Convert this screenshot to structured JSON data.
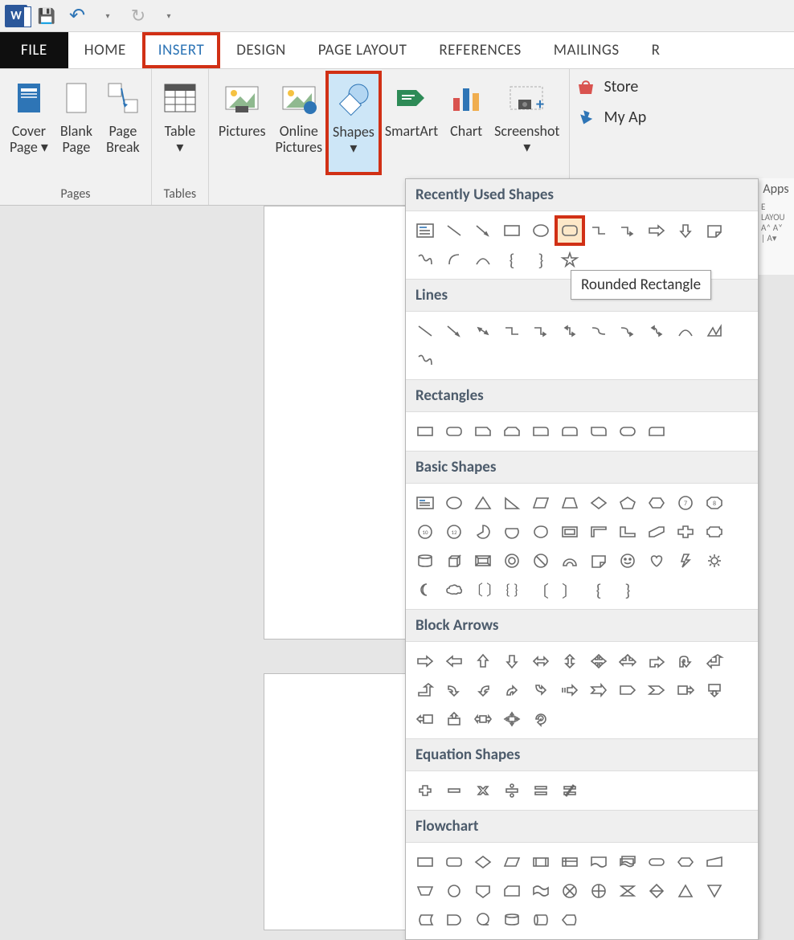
{
  "qat": {
    "save": "💾",
    "undo": "↶",
    "redo": "↻"
  },
  "tabs": [
    "FILE",
    "HOME",
    "INSERT",
    "DESIGN",
    "PAGE LAYOUT",
    "REFERENCES",
    "MAILINGS",
    "R"
  ],
  "ribbon": {
    "pages": {
      "label": "Pages",
      "cover": "Cover\nPage ▾",
      "blank": "Blank\nPage",
      "break": "Page\nBreak"
    },
    "tables": {
      "label": "Tables",
      "table": "Table\n▾"
    },
    "illus": {
      "pictures": "Pictures",
      "online": "Online\nPictures",
      "shapes": "Shapes\n▾",
      "smartart": "SmartArt",
      "chart": "Chart",
      "screenshot": "Screenshot\n▾"
    },
    "apps": {
      "store": "Store",
      "myapps": "My Ap",
      "label": "Apps"
    }
  },
  "gallery": {
    "recent": "Recently Used Shapes",
    "lines": "Lines",
    "rectangles": "Rectangles",
    "basic": "Basic Shapes",
    "block": "Block Arrows",
    "equation": "Equation Shapes",
    "flowchart": "Flowchart"
  },
  "tooltip": "Rounded Rectangle",
  "side": "E LAYOU\nA˄ A˅\n| A▾"
}
